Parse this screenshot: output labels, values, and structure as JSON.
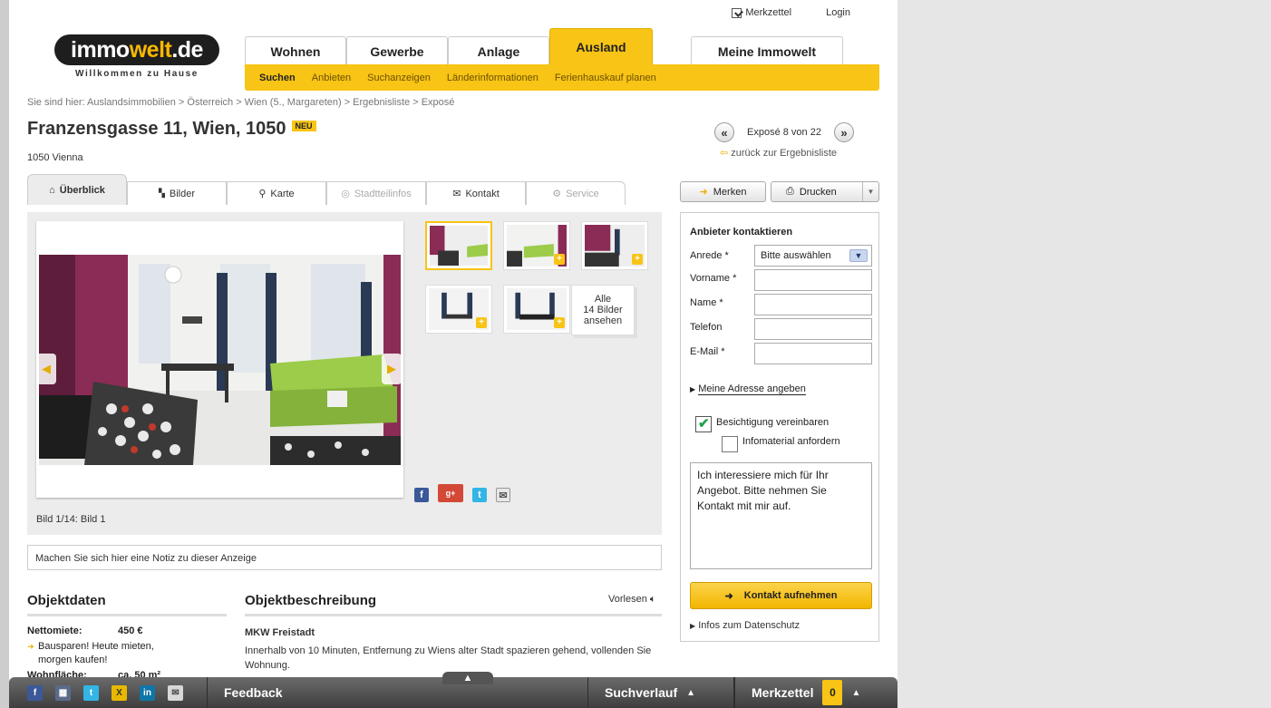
{
  "header": {
    "logo_main": "immo",
    "logo_accent": "welt",
    "logo_tld": ".de",
    "tagline": "Willkommen zu Hause",
    "merkzettel": "Merkzettel",
    "login": "Login"
  },
  "nav": {
    "tabs": [
      "Wohnen",
      "Gewerbe",
      "Anlage",
      "Ausland"
    ],
    "my": "Meine Immowelt",
    "sub": [
      "Suchen",
      "Anbieten",
      "Suchanzeigen",
      "Länderinformationen",
      "Ferienhauskauf planen"
    ]
  },
  "breadcrumb": "Sie sind hier: Auslandsimmobilien > Österreich > Wien (5., Margareten) > Ergebnisliste > Exposé",
  "listing": {
    "title": "Franzensgasse 11, Wien, 1050",
    "badge": "NEU",
    "subtitle": "1050 Vienna",
    "pager_label": "Exposé 8 von 22",
    "back_link": "zurück zur Ergebnisliste"
  },
  "expose_tabs": [
    "Überblick",
    "Bilder",
    "Karte",
    "Stadtteilinfos",
    "Kontakt",
    "Service"
  ],
  "actions": {
    "merken": "Merken",
    "drucken": "Drucken"
  },
  "gallery": {
    "all_line1": "Alle",
    "all_line2": "14 Bilder",
    "all_line3": "ansehen",
    "caption": "Bild 1/14: Bild 1"
  },
  "note_placeholder": "Machen Sie sich hier eine Notiz zu dieser Anzeige",
  "objektdaten": {
    "heading": "Objektdaten",
    "rent_label": "Nettomiete:",
    "rent_value": "450 €",
    "promo_line1": "Bausparen! Heute mieten,",
    "promo_line2": "morgen kaufen!",
    "area_label": "Wohnfläche:",
    "area_value": "ca. 50 m²"
  },
  "beschreibung": {
    "heading": "Objektbeschreibung",
    "vorlesen": "Vorlesen",
    "sub": "MKW Freistadt",
    "text": "Innerhalb von 10 Minuten, Entfernung zu Wiens alter Stadt spazieren gehend, vollenden Sie Wohnung."
  },
  "contact": {
    "title": "Anbieter kontaktieren",
    "anrede_label": "Anrede *",
    "anrede_value": "Bitte auswählen",
    "vorname_label": "Vorname *",
    "name_label": "Name *",
    "telefon_label": "Telefon",
    "email_label": "E-Mail *",
    "address_link": "Meine Adresse angeben",
    "cb1": "Besichtigung vereinbaren",
    "cb2": "Infomaterial anfordern",
    "message": "Ich interessiere mich für Ihr Angebot. Bitte nehmen Sie Kontakt mit mir auf.",
    "submit": "Kontakt aufnehmen",
    "privacy": "Infos zum Datenschutz"
  },
  "bottombar": {
    "feedback": "Feedback",
    "suchverlauf": "Suchverlauf",
    "merkzettel": "Merkzettel",
    "count": "0"
  }
}
